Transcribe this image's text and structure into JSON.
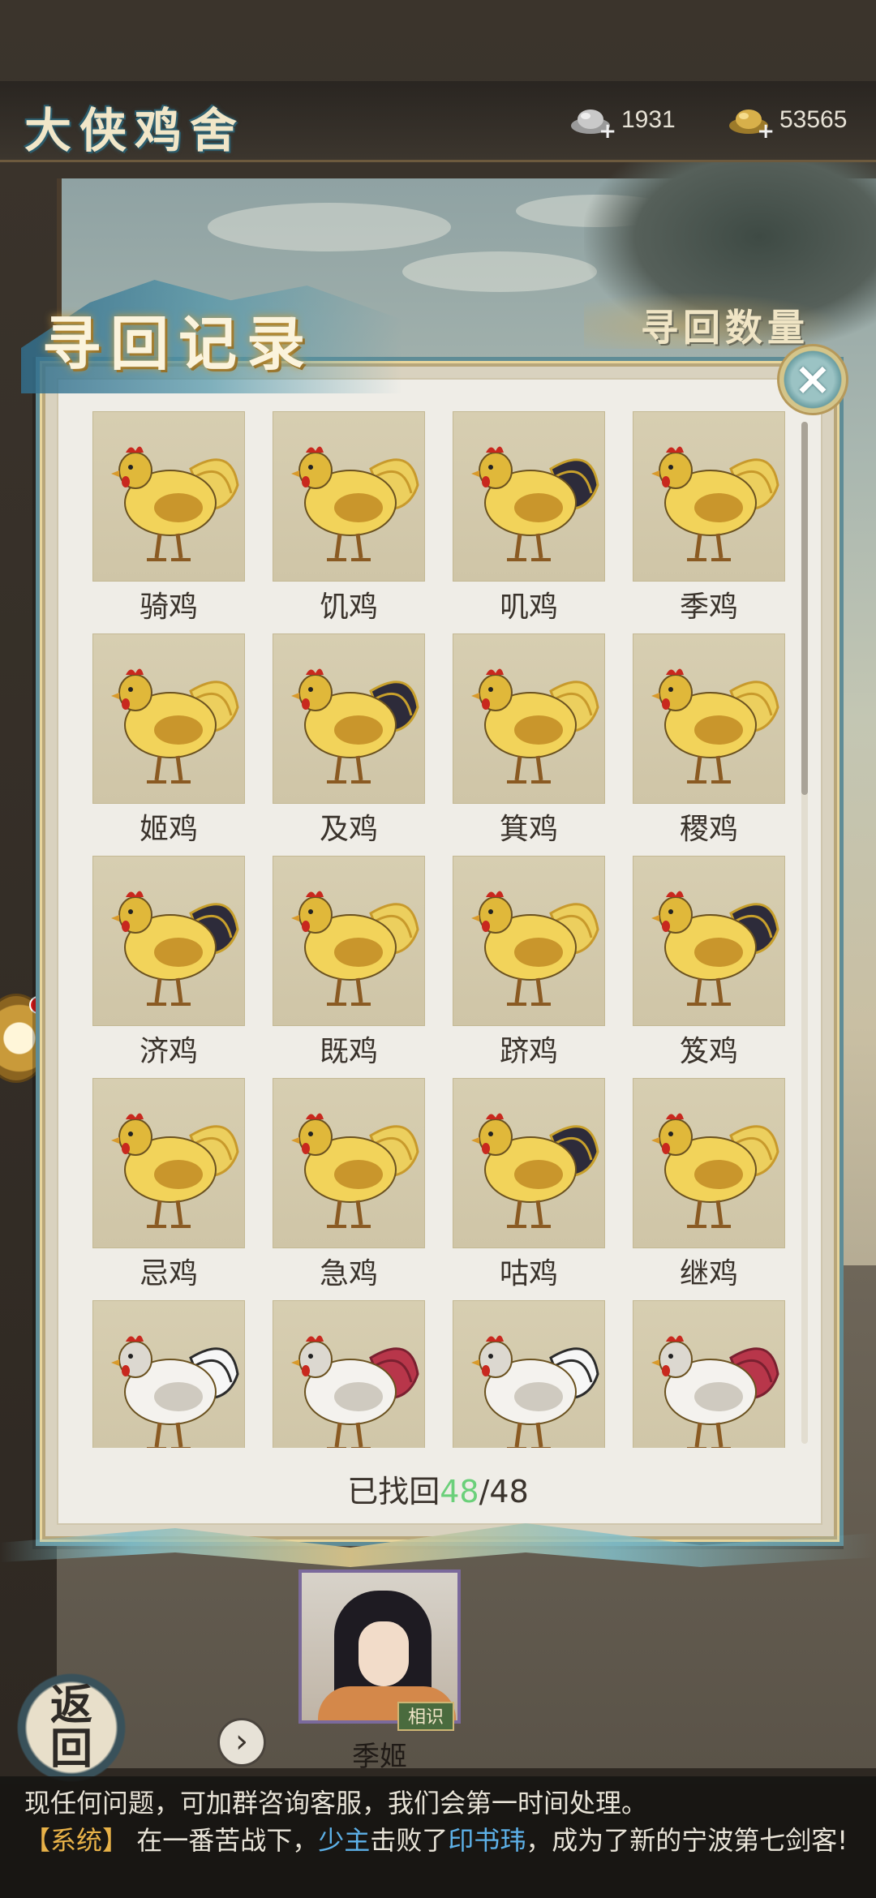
{
  "app": {
    "title": "大侠鸡舍"
  },
  "currency": {
    "silver": {
      "icon": "silver-ingot-icon",
      "value": "1931"
    },
    "gold": {
      "icon": "gold-ingot-icon",
      "value": "53565"
    }
  },
  "modal": {
    "title": "寻回记录",
    "subtitle": "寻回数量",
    "close_icon": "close-icon",
    "items": [
      {
        "name": "骑鸡",
        "style": "yellow"
      },
      {
        "name": "饥鸡",
        "style": "yellow"
      },
      {
        "name": "叽鸡",
        "style": "yellow"
      },
      {
        "name": "季鸡",
        "style": "yellow"
      },
      {
        "name": "姬鸡",
        "style": "yellow"
      },
      {
        "name": "及鸡",
        "style": "yellow"
      },
      {
        "name": "箕鸡",
        "style": "yellow"
      },
      {
        "name": "稷鸡",
        "style": "yellow"
      },
      {
        "name": "济鸡",
        "style": "yellow"
      },
      {
        "name": "既鸡",
        "style": "yellow"
      },
      {
        "name": "跻鸡",
        "style": "yellow"
      },
      {
        "name": "笈鸡",
        "style": "yellow"
      },
      {
        "name": "忌鸡",
        "style": "yellow"
      },
      {
        "name": "急鸡",
        "style": "yellow"
      },
      {
        "name": "咕鸡",
        "style": "yellow"
      },
      {
        "name": "继鸡",
        "style": "yellow"
      },
      {
        "name": "",
        "style": "white"
      },
      {
        "name": "",
        "style": "white"
      },
      {
        "name": "",
        "style": "white"
      },
      {
        "name": "",
        "style": "white"
      }
    ],
    "count_prefix": "已找回",
    "count_found": "48",
    "count_total": "/48"
  },
  "bottom": {
    "character_name": "季姬",
    "character_badge": "相识",
    "back_label_1": "返",
    "back_label_2": "回",
    "next_icon": "chevron-right-icon"
  },
  "chat": {
    "line1": "现任何问题，可加群咨询客服，我们会第一时间处理。",
    "sys_tag": "【系统】",
    "line2_a": " 在一番苦战下，",
    "line2_b": "少主",
    "line2_c": "击败了",
    "line2_d": "印书玮",
    "line2_e": "，成为了新的宁波第七剑客!"
  },
  "colors": {
    "accent_green": "#6bd07a",
    "system_tag": "#e8b248",
    "link_blue": "#5db1e8",
    "panel": "#efede7",
    "tile": "#d7ceb1"
  }
}
